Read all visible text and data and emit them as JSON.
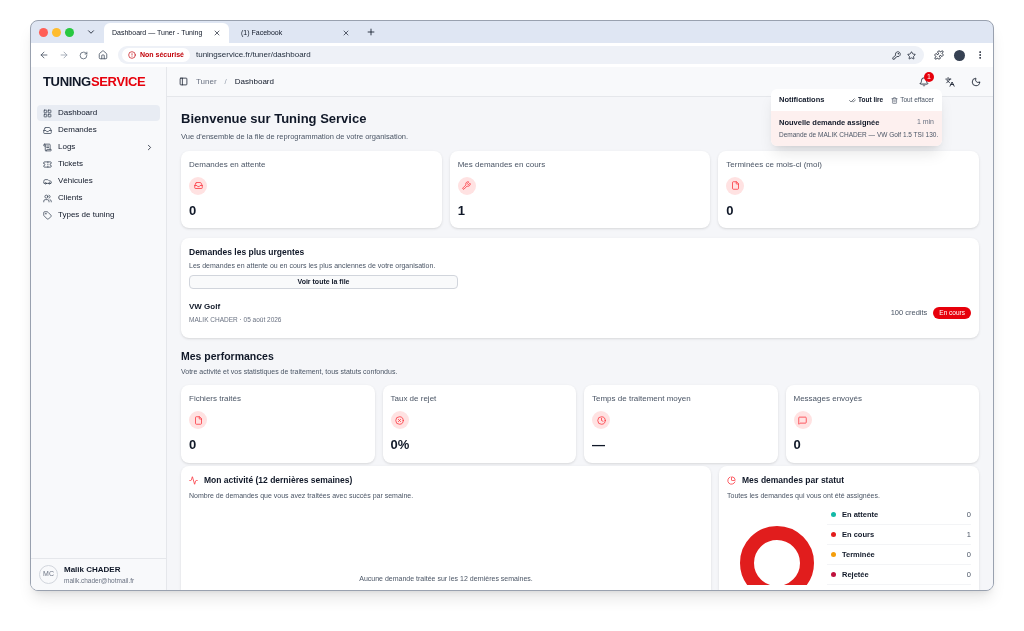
{
  "browser": {
    "tabs": [
      {
        "title": "Dashboard — Tuner - Tuning",
        "selected": true
      },
      {
        "title": "(1) Facebook",
        "selected": false
      }
    ],
    "security": "Non sécurisé",
    "url": "tuningservice.fr/tuner/dashboard"
  },
  "brand": {
    "part1": "TUNING",
    "part2": "SERVICE"
  },
  "sidebar": {
    "items": [
      {
        "label": "Dashboard",
        "selected": true,
        "expandable": false
      },
      {
        "label": "Demandes",
        "selected": false,
        "expandable": false
      },
      {
        "label": "Logs",
        "selected": false,
        "expandable": true
      },
      {
        "label": "Tickets",
        "selected": false,
        "expandable": false
      },
      {
        "label": "Véhicules",
        "selected": false,
        "expandable": false
      },
      {
        "label": "Clients",
        "selected": false,
        "expandable": false
      },
      {
        "label": "Types de tuning",
        "selected": false,
        "expandable": false
      }
    ],
    "user": {
      "initials": "MC",
      "name": "Malik CHADER",
      "email": "malik.chader@hotmail.fr"
    }
  },
  "breadcrumb": {
    "items": [
      "Tuner",
      "Dashboard"
    ],
    "separator": "/"
  },
  "notification_badge": "1",
  "notifications": {
    "title": "Notifications",
    "mark_read": "Tout lire",
    "clear": "Tout effacer",
    "items": [
      {
        "title": "Nouvelle demande assignée",
        "time": "1 min",
        "body": "Demande de MALIK CHADER — VW Golf 1.5 TSI 130.",
        "unread": true
      }
    ]
  },
  "page": {
    "title": "Bienvenue sur Tuning Service",
    "subtitle": "Vue d'ensemble de la file de reprogrammation de votre organisation."
  },
  "stats": [
    {
      "label": "Demandes en attente",
      "value": "0"
    },
    {
      "label": "Mes demandes en cours",
      "value": "1"
    },
    {
      "label": "Terminées ce mois-ci (moi)",
      "value": "0"
    }
  ],
  "urgent": {
    "title": "Demandes les plus urgentes",
    "subtitle": "Les demandes en attente ou en cours les plus anciennes de votre organisation.",
    "button": "Voir toute la file",
    "rows": [
      {
        "vehicle": "VW Golf",
        "meta": "MALIK CHADER · 05 août 2026",
        "credits": "100 credits",
        "status": "En cours"
      }
    ]
  },
  "performance": {
    "title": "Mes performances",
    "subtitle": "Votre activité et vos statistiques de traitement, tous statuts confondus.",
    "cards": [
      {
        "label": "Fichiers traités",
        "value": "0"
      },
      {
        "label": "Taux de rejet",
        "value": "0%"
      },
      {
        "label": "Temps de traitement moyen",
        "value": "—"
      },
      {
        "label": "Messages envoyés",
        "value": "0"
      }
    ]
  },
  "activity": {
    "title": "Mon activité (12 dernières semaines)",
    "subtitle": "Nombre de demandes que vous avez traitées avec succès par semaine.",
    "empty": "Aucune demande traitée sur les 12 dernières semaines."
  },
  "status_chart": {
    "title": "Mes demandes par statut",
    "subtitle": "Toutes les demandes qui vous ont été assignées.",
    "legend": [
      {
        "label": "En attente",
        "value": "0",
        "color": "#14b8a6"
      },
      {
        "label": "En cours",
        "value": "1",
        "color": "#e11d1d"
      },
      {
        "label": "Terminée",
        "value": "0",
        "color": "#f59e0b"
      },
      {
        "label": "Rejetée",
        "value": "0",
        "color": "#be123c"
      }
    ]
  }
}
